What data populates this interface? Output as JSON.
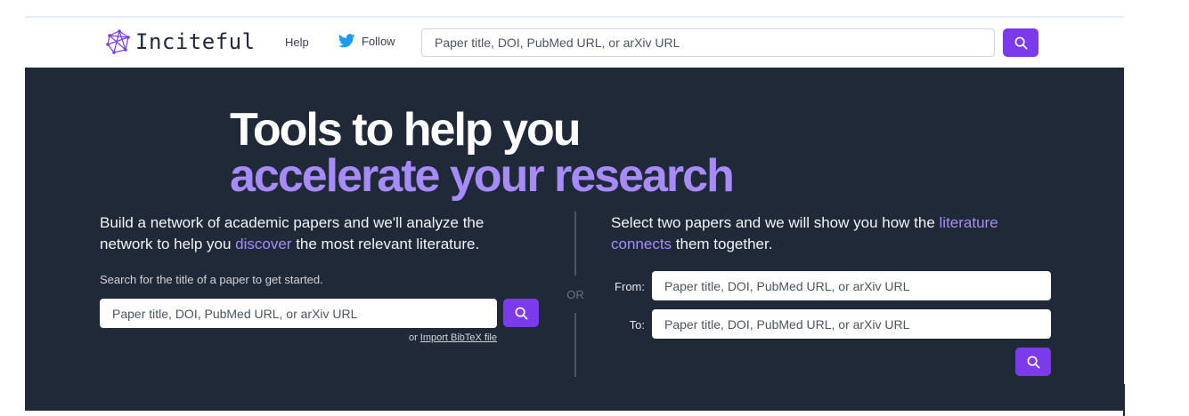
{
  "brand": {
    "name": "Inciteful"
  },
  "nav": {
    "help": "Help",
    "follow": "Follow",
    "search_placeholder": "Paper title, DOI, PubMed URL, or arXiv URL"
  },
  "hero": {
    "title_line1": "Tools to help you",
    "title_line2": "accelerate your research",
    "left": {
      "desc_before": "Build a network of academic papers and we'll analyze the network to help you ",
      "desc_highlight": "discover",
      "desc_after": " the most relevant literature.",
      "hint": "Search for the title of a paper to get started.",
      "search_placeholder": "Paper title, DOI, PubMed URL, or arXiv URL",
      "import_prefix": "or ",
      "import_link": "Import BibTeX file"
    },
    "or": "OR",
    "right": {
      "desc_before": "Select two papers and we will show you how the ",
      "desc_highlight": "literature connects",
      "desc_after": " them together.",
      "from_label": "From:",
      "from_placeholder": "Paper title, DOI, PubMed URL, or arXiv URL",
      "to_label": "To:",
      "to_placeholder": "Paper title, DOI, PubMed URL, or arXiv URL"
    }
  },
  "colors": {
    "accent": "#7c3aed",
    "highlight": "#a78bfa",
    "hero_bg": "#1f2937"
  },
  "icons": [
    "inciteful-logo-icon",
    "twitter-icon",
    "search-icon"
  ]
}
